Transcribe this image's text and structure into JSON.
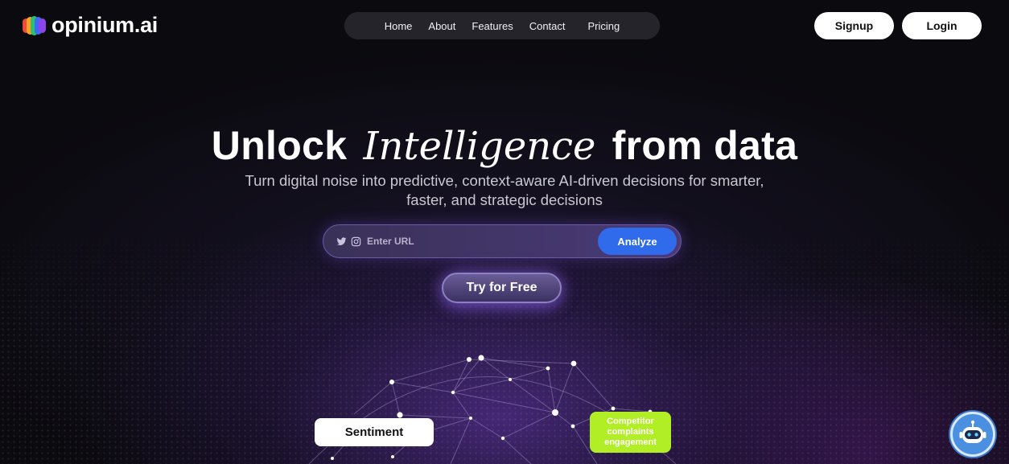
{
  "brand": {
    "name": "opinium.ai",
    "logo_colors": [
      "#f04a3c",
      "#f6a623",
      "#2fbf71",
      "#3b6cf5",
      "#8e44ec"
    ]
  },
  "nav": {
    "items": [
      {
        "id": "home",
        "label": "Home"
      },
      {
        "id": "about",
        "label": "About"
      },
      {
        "id": "features",
        "label": "Features"
      },
      {
        "id": "contact",
        "label": "Contact"
      },
      {
        "id": "pricing",
        "label": "Pricing"
      }
    ]
  },
  "auth": {
    "signup_label": "Signup",
    "login_label": "Login"
  },
  "hero": {
    "title_part1": "Unlock",
    "title_accent": "Intelligence",
    "title_part2": "from data",
    "subtitle": "Turn digital noise into predictive, context-aware AI-driven decisions for smarter, faster, and strategic decisions"
  },
  "url_search": {
    "placeholder": "Enter URL",
    "value": "",
    "icons": [
      "twitter-icon",
      "instagram-icon"
    ],
    "analyze_label": "Analyze"
  },
  "cta": {
    "try_label": "Try for Free"
  },
  "tags": {
    "sentiment": "Sentiment",
    "competitor_lines": [
      "Competitor",
      "complaints",
      "engagement"
    ]
  },
  "colors": {
    "accent_blue": "#2f6bea",
    "accent_lime": "#b2ee26",
    "nav_bg": "#25242b",
    "page_bg": "#0b0a0f"
  },
  "chatbot": {
    "icon": "robot-icon"
  }
}
